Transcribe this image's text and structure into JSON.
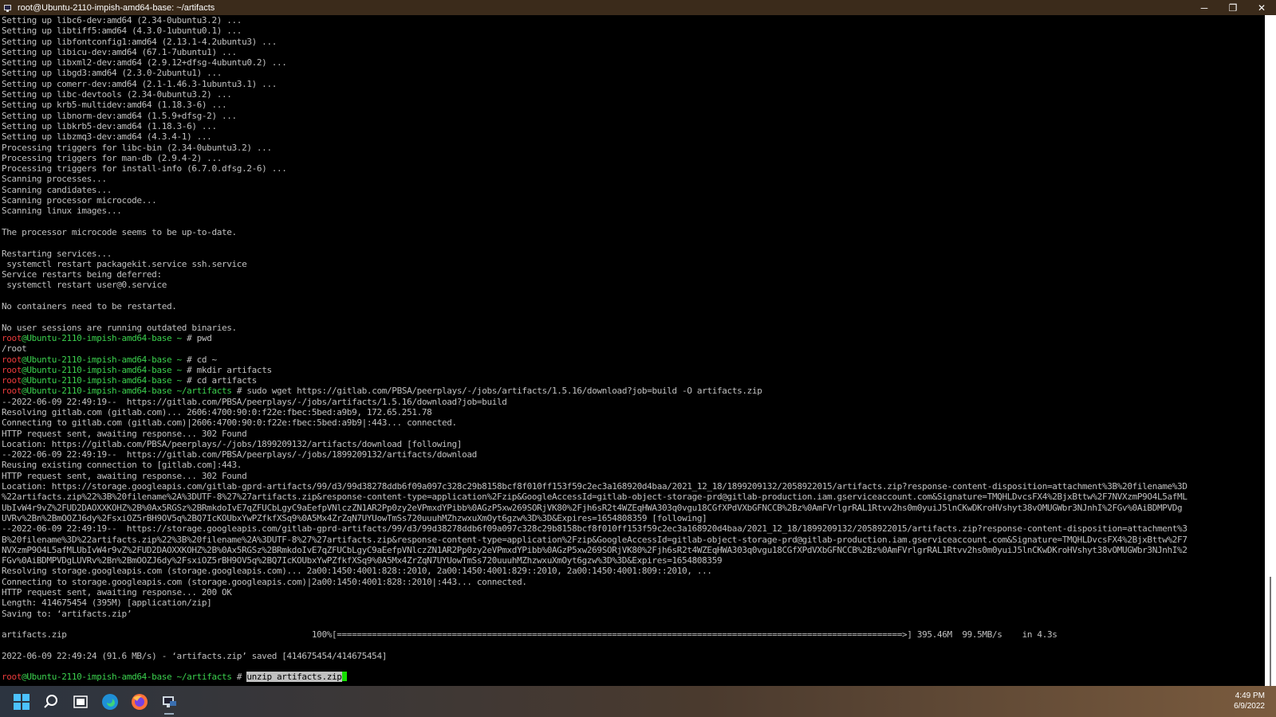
{
  "window": {
    "title": "root@Ubuntu-2110-impish-amd64-base: ~/artifacts",
    "minimize_glyph": "─",
    "maximize_glyph": "❐",
    "close_glyph": "✕"
  },
  "terminal": {
    "lines": [
      {
        "t": "Setting up libc6-dev:amd64 (2.34-0ubuntu3.2) ..."
      },
      {
        "t": "Setting up libtiff5:amd64 (4.3.0-1ubuntu0.1) ..."
      },
      {
        "t": "Setting up libfontconfig1:amd64 (2.13.1-4.2ubuntu3) ..."
      },
      {
        "t": "Setting up libicu-dev:amd64 (67.1-7ubuntu1) ..."
      },
      {
        "t": "Setting up libxml2-dev:amd64 (2.9.12+dfsg-4ubuntu0.2) ..."
      },
      {
        "t": "Setting up libgd3:amd64 (2.3.0-2ubuntu1) ..."
      },
      {
        "t": "Setting up comerr-dev:amd64 (2.1-1.46.3-1ubuntu3.1) ..."
      },
      {
        "t": "Setting up libc-devtools (2.34-0ubuntu3.2) ..."
      },
      {
        "t": "Setting up krb5-multidev:amd64 (1.18.3-6) ..."
      },
      {
        "t": "Setting up libnorm-dev:amd64 (1.5.9+dfsg-2) ..."
      },
      {
        "t": "Setting up libkrb5-dev:amd64 (1.18.3-6) ..."
      },
      {
        "t": "Setting up libzmq3-dev:amd64 (4.3.4-1) ..."
      },
      {
        "t": "Processing triggers for libc-bin (2.34-0ubuntu3.2) ..."
      },
      {
        "t": "Processing triggers for man-db (2.9.4-2) ..."
      },
      {
        "t": "Processing triggers for install-info (6.7.0.dfsg.2-6) ..."
      },
      {
        "t": "Scanning processes..."
      },
      {
        "t": "Scanning candidates..."
      },
      {
        "t": "Scanning processor microcode..."
      },
      {
        "t": "Scanning linux images..."
      },
      {
        "t": ""
      },
      {
        "t": "The processor microcode seems to be up-to-date."
      },
      {
        "t": ""
      },
      {
        "t": "Restarting services..."
      },
      {
        "t": " systemctl restart packagekit.service ssh.service"
      },
      {
        "t": "Service restarts being deferred:"
      },
      {
        "t": " systemctl restart user@0.service"
      },
      {
        "t": ""
      },
      {
        "t": "No containers need to be restarted."
      },
      {
        "t": ""
      },
      {
        "t": "No user sessions are running outdated binaries."
      },
      {
        "prompt": true,
        "user": "root",
        "host": "@Ubuntu-2110-impish-amd64-base",
        "path": " ~",
        "sym": " # ",
        "cmd": "pwd"
      },
      {
        "t": "/root"
      },
      {
        "prompt": true,
        "user": "root",
        "host": "@Ubuntu-2110-impish-amd64-base",
        "path": " ~",
        "sym": " # ",
        "cmd": "cd ~"
      },
      {
        "prompt": true,
        "user": "root",
        "host": "@Ubuntu-2110-impish-amd64-base",
        "path": " ~",
        "sym": " # ",
        "cmd": "mkdir artifacts"
      },
      {
        "prompt": true,
        "user": "root",
        "host": "@Ubuntu-2110-impish-amd64-base",
        "path": " ~",
        "sym": " # ",
        "cmd": "cd artifacts"
      },
      {
        "prompt": true,
        "user": "root",
        "host": "@Ubuntu-2110-impish-amd64-base",
        "path": " ~/artifacts",
        "sym": " # ",
        "cmd": "sudo wget https://gitlab.com/PBSA/peerplays/-/jobs/artifacts/1.5.16/download?job=build -O artifacts.zip"
      },
      {
        "t": "--2022-06-09 22:49:19--  https://gitlab.com/PBSA/peerplays/-/jobs/artifacts/1.5.16/download?job=build"
      },
      {
        "t": "Resolving gitlab.com (gitlab.com)... 2606:4700:90:0:f22e:fbec:5bed:a9b9, 172.65.251.78"
      },
      {
        "t": "Connecting to gitlab.com (gitlab.com)|2606:4700:90:0:f22e:fbec:5bed:a9b9|:443... connected."
      },
      {
        "t": "HTTP request sent, awaiting response... 302 Found"
      },
      {
        "t": "Location: https://gitlab.com/PBSA/peerplays/-/jobs/1899209132/artifacts/download [following]"
      },
      {
        "t": "--2022-06-09 22:49:19--  https://gitlab.com/PBSA/peerplays/-/jobs/1899209132/artifacts/download"
      },
      {
        "t": "Reusing existing connection to [gitlab.com]:443."
      },
      {
        "t": "HTTP request sent, awaiting response... 302 Found"
      },
      {
        "t": "Location: https://storage.googleapis.com/gitlab-gprd-artifacts/99/d3/99d38278ddb6f09a097c328c29b8158bcf8f010ff153f59c2ec3a168920d4baa/2021_12_18/1899209132/2058922015/artifacts.zip?response-content-disposition=attachment%3B%20filename%3D"
      },
      {
        "t": "%22artifacts.zip%22%3B%20filename%2A%3DUTF-8%27%27artifacts.zip&response-content-type=application%2Fzip&GoogleAccessId=gitlab-object-storage-prd@gitlab-production.iam.gserviceaccount.com&Signature=TMQHLDvcsFX4%2BjxBttw%2F7NVXzmP9O4L5afML"
      },
      {
        "t": "UbIvW4r9vZ%2FUD2DAOXXKOHZ%2B%0Ax5RGSz%2BRmkdoIvE7qZFUCbLgyC9aEefpVNlczZN1AR2Pp0zy2eVPmxdYPibb%0AGzP5xw269SORjVK80%2Fjh6sR2t4WZEqHWA303q0vgu18CGfXPdVXbGFNCCB%2Bz%0AmFVrlgrRAL1Rtvv2hs0m0yuiJ5lnCKwDKroHVshyt38vOMUGWbr3NJnhI%2FGv%0AiBDMPVDg"
      },
      {
        "t": "UVRv%2Bn%2BmOOZJ6dy%2FsxiOZ5rBH9OV5q%2BQ7IcKOUbxYwPZfkfXSq9%0A5Mx4ZrZqN7UYUowTmSs720uuuhMZhzwxuXmOyt6gzw%3D%3D&Expires=1654808359 [following]"
      },
      {
        "t": "--2022-06-09 22:49:19--  https://storage.googleapis.com/gitlab-gprd-artifacts/99/d3/99d38278ddb6f09a097c328c29b8158bcf8f010ff153f59c2ec3a168920d4baa/2021_12_18/1899209132/2058922015/artifacts.zip?response-content-disposition=attachment%3"
      },
      {
        "t": "B%20filename%3D%22artifacts.zip%22%3B%20filename%2A%3DUTF-8%27%27artifacts.zip&response-content-type=application%2Fzip&GoogleAccessId=gitlab-object-storage-prd@gitlab-production.iam.gserviceaccount.com&Signature=TMQHLDvcsFX4%2BjxBttw%2F7"
      },
      {
        "t": "NVXzmP9O4L5afMLUbIvW4r9vZ%2FUD2DAOXXKOHZ%2B%0Ax5RGSz%2BRmkdoIvE7qZFUCbLgyC9aEefpVNlczZN1AR2Pp0zy2eVPmxdYPibb%0AGzP5xw269SORjVK80%2Fjh6sR2t4WZEqHWA303q0vgu18CGfXPdVXbGFNCCB%2Bz%0AmFVrlgrRAL1Rtvv2hs0m0yuiJ5lnCKwDKroHVshyt38vOMUGWbr3NJnhI%2"
      },
      {
        "t": "FGv%0AiBDMPVDgLUVRv%2Bn%2BmOOZJ6dy%2FsxiOZ5rBH9OV5q%2BQ7IcKOUbxYwPZfkfXSq9%0A5Mx4ZrZqN7UYUowTmSs720uuuhMZhzwxuXmOyt6gzw%3D%3D&Expires=1654808359"
      },
      {
        "t": "Resolving storage.googleapis.com (storage.googleapis.com)... 2a00:1450:4001:828::2010, 2a00:1450:4001:829::2010, 2a00:1450:4001:809::2010, ..."
      },
      {
        "t": "Connecting to storage.googleapis.com (storage.googleapis.com)|2a00:1450:4001:828::2010|:443... connected."
      },
      {
        "t": "HTTP request sent, awaiting response... 200 OK"
      },
      {
        "t": "Length: 414675454 (395M) [application/zip]"
      },
      {
        "t": "Saving to: ‘artifacts.zip’"
      },
      {
        "t": ""
      },
      {
        "t": "artifacts.zip                                                 100%[=================================================================================================================>] 395.46M  99.5MB/s    in 4.3s"
      },
      {
        "t": ""
      },
      {
        "t": "2022-06-09 22:49:24 (91.6 MB/s) - ‘artifacts.zip’ saved [414675454/414675454]"
      },
      {
        "t": ""
      },
      {
        "prompt": true,
        "current": true,
        "user": "root",
        "host": "@Ubuntu-2110-impish-amd64-base",
        "path": " ~/artifacts",
        "sym": " # ",
        "cmd": "unzip artifacts.zip"
      }
    ],
    "progress": {
      "file": "artifacts.zip",
      "percent": 100,
      "downloaded": "395.46M",
      "rate": "99.5MB/s",
      "elapsed": "in 4.3s"
    }
  },
  "taskbar": {
    "items": [
      {
        "name": "start-button",
        "icon": "windows-logo-icon"
      },
      {
        "name": "search-button",
        "icon": "search-icon"
      },
      {
        "name": "task-view-button",
        "icon": "task-view-icon"
      },
      {
        "name": "edge-button",
        "icon": "edge-icon"
      },
      {
        "name": "firefox-button",
        "icon": "firefox-icon"
      },
      {
        "name": "terminal-button",
        "icon": "terminal-icon",
        "active": true
      }
    ],
    "clock": {
      "time": "4:49 PM",
      "date": "6/9/2022"
    }
  },
  "colors": {
    "prompt_user": "#e83b3b",
    "prompt_host": "#3bd14e",
    "cursor": "#16e000",
    "terminal_bg": "#000000",
    "terminal_fg": "#c0c0c0"
  }
}
